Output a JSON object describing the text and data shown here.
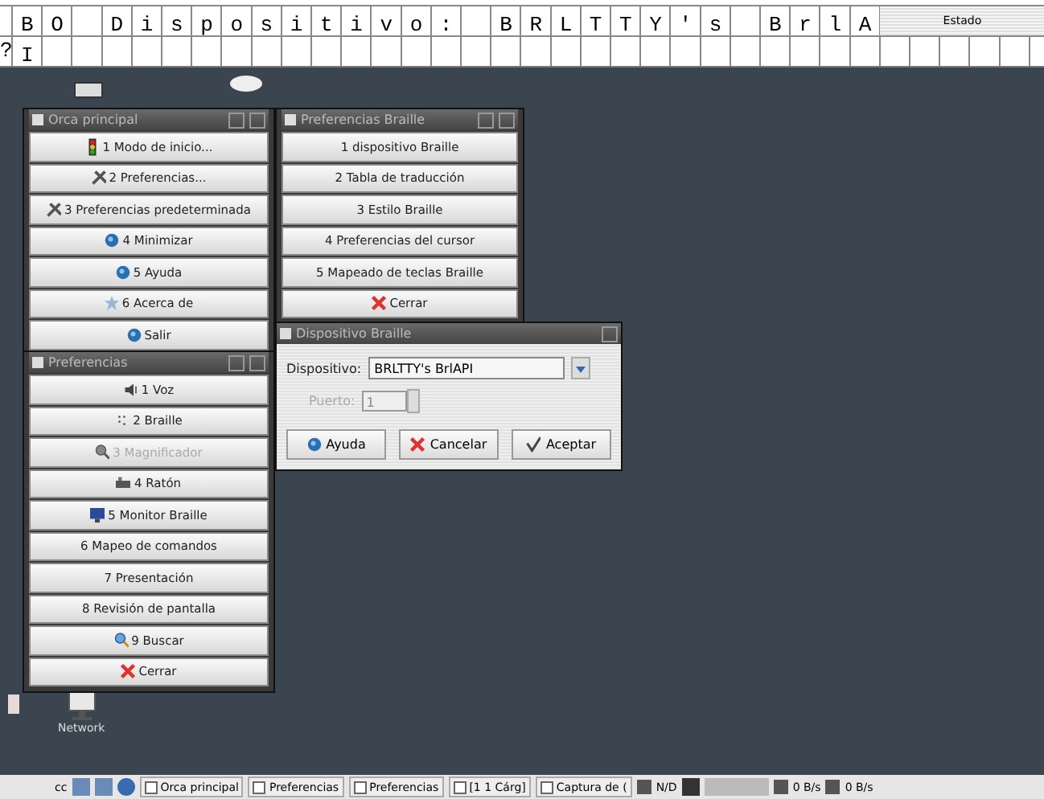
{
  "braille_display": {
    "rows": [
      {
        "text": "BO Dispositivo: BRLTTY's BrlA"
      },
      {
        "lead": "?",
        "text": "I"
      }
    ],
    "status_label": "Estado"
  },
  "windows": [
    {
      "title": "Orca principal",
      "buttons": [
        {
          "label": "1 Modo de inicio..."
        },
        {
          "label": "2 Preferencias..."
        },
        {
          "label": "3 Preferencias predeterminada"
        },
        {
          "label": "4 Minimizar"
        },
        {
          "label": "5 Ayuda"
        },
        {
          "label": "6 Acerca de"
        },
        {
          "label": "Salir"
        }
      ]
    },
    {
      "title": "Preferencias Braille",
      "buttons": [
        {
          "label": "1 dispositivo Braille"
        },
        {
          "label": "2 Tabla de traducción"
        },
        {
          "label": "3 Estilo Braille"
        },
        {
          "label": "4 Preferencias del cursor"
        },
        {
          "label": "5 Mapeado de teclas Braille"
        },
        {
          "label": "Cerrar"
        }
      ]
    },
    {
      "title": "Preferencias",
      "buttons": [
        {
          "label": "1 Voz",
          "disabled": false
        },
        {
          "label": "2 Braille",
          "disabled": false
        },
        {
          "label": "3 Magnificador",
          "disabled": true
        },
        {
          "label": "4 Ratón",
          "disabled": false
        },
        {
          "label": "5 Monitor Braille",
          "disabled": false
        },
        {
          "label": "6 Mapeo de comandos",
          "disabled": false
        },
        {
          "label": "7 Presentación",
          "disabled": false
        },
        {
          "label": "8 Revisión de pantalla",
          "disabled": false
        },
        {
          "label": "9 Buscar",
          "disabled": false
        },
        {
          "label": "Cerrar",
          "disabled": false
        }
      ]
    }
  ],
  "dialog": {
    "title": "Dispositivo Braille",
    "device_label": "Dispositivo:",
    "device_value": "BRLTTY's BrlAPI",
    "port_label": "Puerto:",
    "port_value": "1",
    "port_disabled": true,
    "buttons": [
      "Ayuda",
      "Cancelar",
      "Aceptar"
    ]
  },
  "desktop_icon": {
    "label": "Network"
  },
  "taskbar": {
    "label": "cc",
    "tasks": [
      "Orca principal",
      "Preferencias",
      "Preferencias",
      "[1 1 Cárg]",
      "Captura de ("
    ],
    "status": "N/D",
    "rates": [
      "0 B/s",
      "0 B/s"
    ]
  }
}
